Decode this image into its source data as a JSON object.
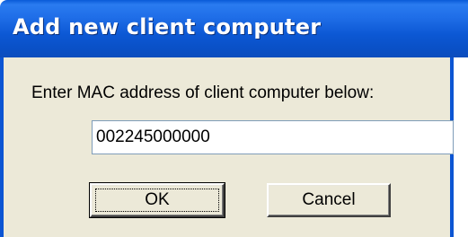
{
  "window": {
    "title": "Add new client computer"
  },
  "form": {
    "prompt": "Enter MAC address of client computer below:",
    "mac_value": "002245000000"
  },
  "buttons": {
    "ok_label": "OK",
    "cancel_label": "Cancel"
  },
  "colors": {
    "titlebar": "#0c58d4",
    "dialog_background": "#ece9d8",
    "title_text": "#ffffff"
  }
}
